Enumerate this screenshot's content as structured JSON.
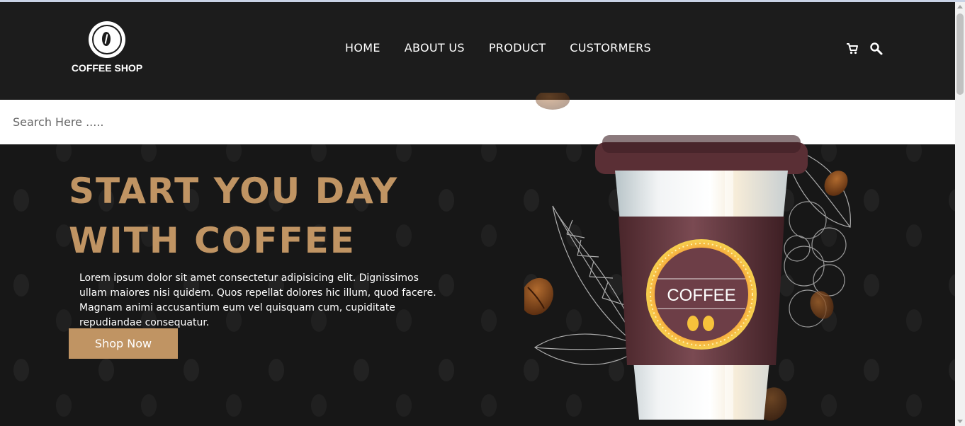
{
  "brand": {
    "name": "COFFEE SHOP"
  },
  "nav": {
    "items": [
      {
        "label": "HOME"
      },
      {
        "label": "ABOUT US"
      },
      {
        "label": "PRODUCT"
      },
      {
        "label": "CUSTORMERS"
      }
    ]
  },
  "header_icons": {
    "cart": "cart-icon",
    "search": "search-icon"
  },
  "search": {
    "placeholder": "Search Here .....",
    "value": ""
  },
  "hero": {
    "headline_line1": "START YOU DAY",
    "headline_line2": "WITH COFFEE",
    "description": "Lorem ipsum dolor sit amet consectetur adipisicing elit. Dignissimos ullam maiores nisi quidem. Quos repellat dolores hic illum, quod facere. Magnam animi accusantium eum vel quisquam cum, cupiditate repudiandae consequatur.",
    "cta_label": "Shop Now",
    "cup_label": "COFFEE"
  },
  "colors": {
    "accent": "#c09463",
    "header_bg": "#1c1c1c",
    "page_bg": "#171717",
    "cup_sleeve": "#5a2f35"
  }
}
